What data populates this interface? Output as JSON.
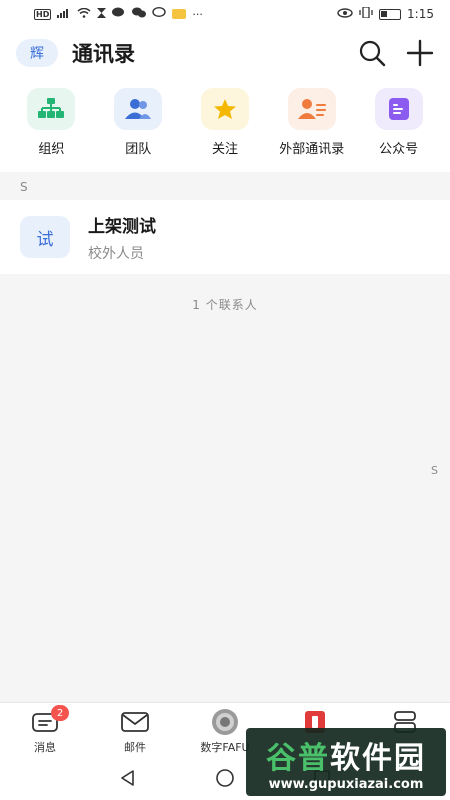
{
  "status_bar": {
    "left_icons": [
      "hd-icon",
      "signal-icon",
      "wifi-icon",
      "hourglass-icon",
      "wechat-icon",
      "wechat-icon",
      "chat-icon",
      "mail-icon"
    ],
    "overflow": "···",
    "time": "1:15"
  },
  "header": {
    "avatar_text": "辉",
    "title": "通讯录"
  },
  "shortcuts": [
    {
      "label": "组织",
      "icon": "org-icon",
      "bg": "#e7f7ef",
      "color": "#22b573"
    },
    {
      "label": "团队",
      "icon": "team-icon",
      "bg": "#e8f0fc",
      "color": "#3b6fd6"
    },
    {
      "label": "关注",
      "icon": "star-icon",
      "bg": "#fdf6dc",
      "color": "#f5b800"
    },
    {
      "label": "外部通讯录",
      "icon": "external-contacts-icon",
      "bg": "#fdeee6",
      "color": "#f07b3f"
    },
    {
      "label": "公众号",
      "icon": "official-account-icon",
      "bg": "#efeafc",
      "color": "#8c5cf0"
    }
  ],
  "section_letter": "S",
  "contact": {
    "avatar_text": "试",
    "name": "上架测试",
    "desc": "校外人员"
  },
  "contact_count": "1 个联系人",
  "index_letter": "S",
  "tabbar": [
    {
      "label": "消息",
      "badge": "2"
    },
    {
      "label": "邮件"
    },
    {
      "label": "数字FAFU"
    },
    {
      "label": ""
    },
    {
      "label": ""
    }
  ],
  "watermark": {
    "title_a": "谷普",
    "title_b": "软件园",
    "url": "www.gupuxiazai.com"
  }
}
